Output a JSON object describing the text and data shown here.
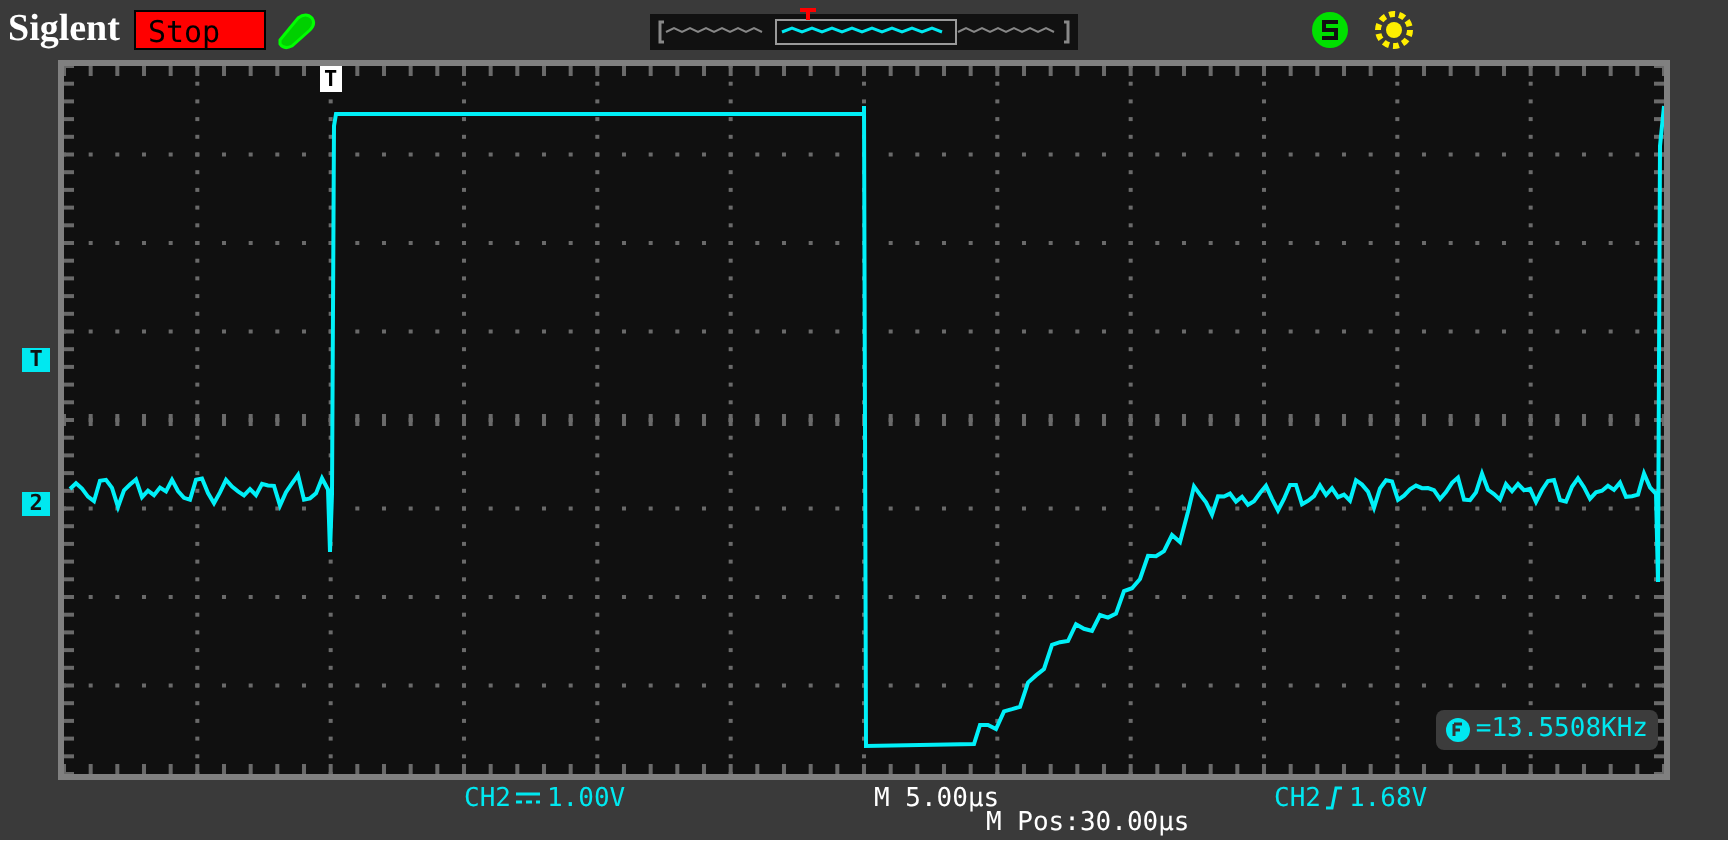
{
  "brand": "Siglent",
  "run_state": {
    "label": "Stop",
    "kind": "stop"
  },
  "trigger_position_marker": "T",
  "trigger_level_marker": "T",
  "channel_marker": "2",
  "frequency": "=13.5508KHz",
  "channel_scale": {
    "channel": "CH2",
    "value": "1.00V"
  },
  "timebase": "M 5.00μs",
  "trigger": {
    "source": "CH2",
    "level": "1.68V"
  },
  "position": "M Pos:30.00μs"
}
